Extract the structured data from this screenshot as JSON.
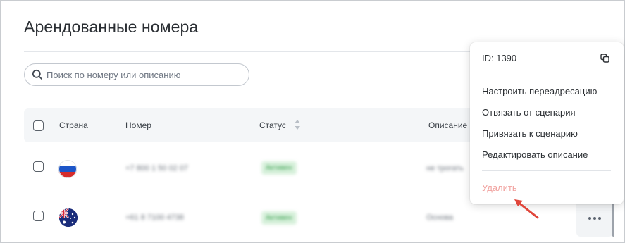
{
  "page": {
    "title": "Арендованные номера"
  },
  "search": {
    "placeholder": "Поиск по номеру или описанию",
    "value": ""
  },
  "table": {
    "columns": {
      "country": "Страна",
      "number": "Номер",
      "status": "Статус",
      "description": "Описание"
    },
    "rows": [
      {
        "flag": "russia-flag",
        "number": "+7 800 1 50 02 07",
        "status": "Активен",
        "description": "не трогать"
      },
      {
        "flag": "australia-flag",
        "number": "+61 8 7100 4738",
        "status": "Активен",
        "description": "Основа"
      }
    ]
  },
  "menu": {
    "id_label": "ID: 1390",
    "items": [
      "Настроить переадресацию",
      "Отвязать от сценария",
      "Привязать к сценарию",
      "Редактировать описание"
    ],
    "delete_label": "Удалить"
  },
  "icons": {
    "search": "search-icon",
    "copy": "copy-icon",
    "sort": "sort-icon",
    "more": "more-dots-icon"
  },
  "colors": {
    "accent_badge": "#d8f1dc",
    "delete": "#f1a3a0",
    "arrow": "#e0453a"
  }
}
